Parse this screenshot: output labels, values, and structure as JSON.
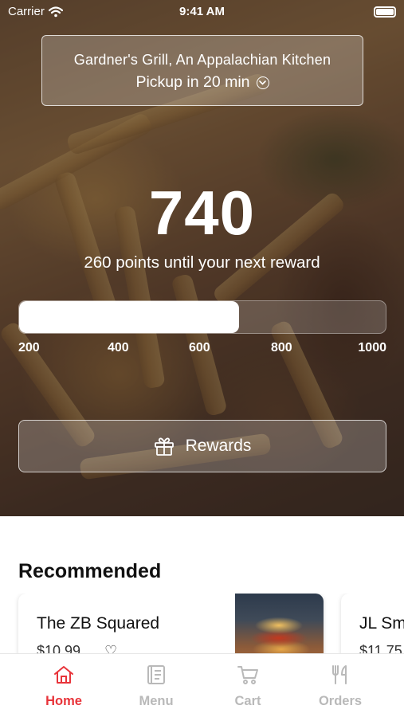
{
  "status_bar": {
    "carrier": "Carrier",
    "time": "9:41 AM"
  },
  "location": {
    "name": "Gardner's Grill, An Appalachian Kitchen",
    "pickup": "Pickup in 20 min"
  },
  "rewards": {
    "points": "740",
    "points_until": "260 points until your next reward",
    "progress_fraction": 0.6,
    "ticks": [
      "200",
      "400",
      "600",
      "800",
      "1000"
    ],
    "button_label": "Rewards"
  },
  "recommended": {
    "title": "Recommended",
    "items": [
      {
        "name": "The ZB Squared",
        "price": "$10.99"
      },
      {
        "name": "JL Sm",
        "price": "$11.75"
      }
    ]
  },
  "tabs": [
    {
      "label": "Home",
      "icon": "home-icon",
      "active": true
    },
    {
      "label": "Menu",
      "icon": "menu-book-icon",
      "active": false
    },
    {
      "label": "Cart",
      "icon": "cart-icon",
      "active": false
    },
    {
      "label": "Orders",
      "icon": "fork-knife-icon",
      "active": false
    }
  ],
  "colors": {
    "accent": "#e8343a",
    "inactive_tab": "#b9b9b9"
  }
}
